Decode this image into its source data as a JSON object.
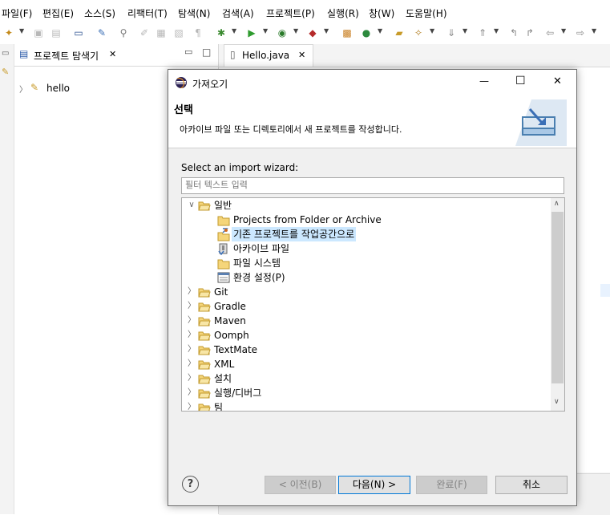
{
  "menu": [
    "파일(F)",
    "편집(E)",
    "소스(S)",
    "리팩터(T)",
    "탐색(N)",
    "검색(A)",
    "프로젝트(P)",
    "실행(R)",
    "창(W)",
    "도움말(H)"
  ],
  "explorer": {
    "tab_title": "프로젝트 탐색기",
    "close": "✕",
    "minimize": "▭",
    "maximize": "□",
    "project": "hello"
  },
  "editor": {
    "tab_title": "Hello.java",
    "close": "✕"
  },
  "dialog": {
    "title": "가져오기",
    "heading": "선택",
    "description": "아카이브 파일 또는 디렉토리에서 새 프로젝트를 작성합니다.",
    "wizard_label": "Select an import wizard:",
    "filter_placeholder": "필터 텍스트 입력",
    "tree": [
      {
        "label": "일반",
        "level": 0,
        "expanded": true,
        "icon": "folder-open",
        "selected": false
      },
      {
        "label": "Projects from Folder or Archive",
        "level": 1,
        "expanded": null,
        "icon": "folder",
        "selected": false
      },
      {
        "label": "기존 프로젝트를 작업공간으로",
        "level": 1,
        "expanded": null,
        "icon": "project-import",
        "selected": true
      },
      {
        "label": "아카이브 파일",
        "level": 1,
        "expanded": null,
        "icon": "archive",
        "selected": false
      },
      {
        "label": "파일 시스템",
        "level": 1,
        "expanded": null,
        "icon": "folder",
        "selected": false
      },
      {
        "label": "환경 설정(P)",
        "level": 1,
        "expanded": null,
        "icon": "preferences",
        "selected": false
      },
      {
        "label": "Git",
        "level": 0,
        "expanded": false,
        "icon": "folder-open",
        "selected": false
      },
      {
        "label": "Gradle",
        "level": 0,
        "expanded": false,
        "icon": "folder-open",
        "selected": false
      },
      {
        "label": "Maven",
        "level": 0,
        "expanded": false,
        "icon": "folder-open",
        "selected": false
      },
      {
        "label": "Oomph",
        "level": 0,
        "expanded": false,
        "icon": "folder-open",
        "selected": false
      },
      {
        "label": "TextMate",
        "level": 0,
        "expanded": false,
        "icon": "folder-open",
        "selected": false
      },
      {
        "label": "XML",
        "level": 0,
        "expanded": false,
        "icon": "folder-open",
        "selected": false
      },
      {
        "label": "설치",
        "level": 0,
        "expanded": false,
        "icon": "folder-open",
        "selected": false
      },
      {
        "label": "실행/디버그",
        "level": 0,
        "expanded": false,
        "icon": "folder-open",
        "selected": false
      },
      {
        "label": "팀",
        "level": 0,
        "expanded": false,
        "icon": "folder-open",
        "selected": false
      }
    ],
    "buttons": {
      "help": "?",
      "back": "< 이전(B)",
      "next": "다음(N) >",
      "finish": "완료(F)",
      "cancel": "취소"
    },
    "window_controls": {
      "minimize": "—",
      "maximize": "☐",
      "close": "✕"
    }
  }
}
